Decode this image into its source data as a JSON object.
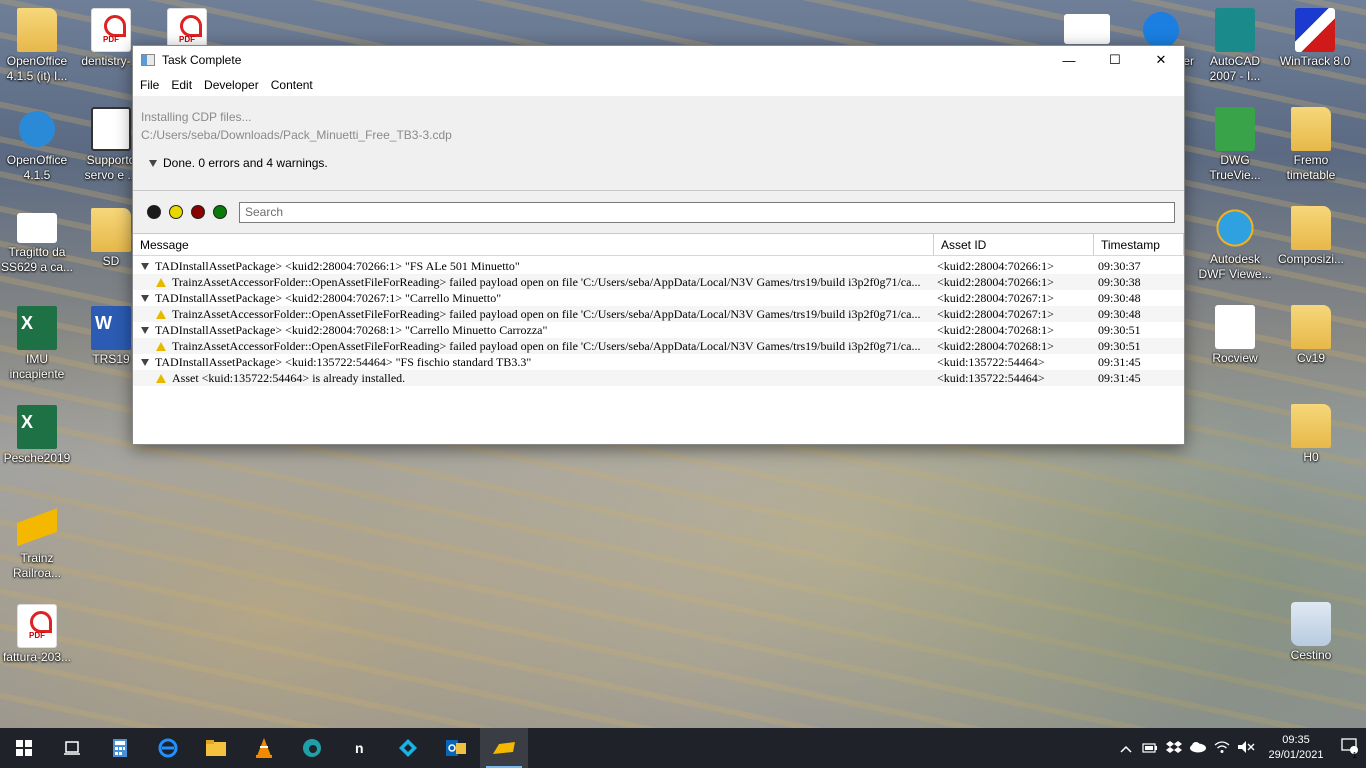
{
  "desktop": {
    "icons_left": [
      {
        "label": "OpenOffice\n4.1.5 (it) I..."
      },
      {
        "label": "dentistry-..."
      },
      {
        "label": "OpenOffice\n4.1.5"
      },
      {
        "label": "Supporto\nservo e ..."
      },
      {
        "label": "Tragitto da\nSS629 a ca..."
      },
      {
        "label": "SD"
      },
      {
        "label": "IMU\nincapiente"
      },
      {
        "label": "TRS19"
      },
      {
        "label": "Pesche2019"
      },
      {
        "label": "Trainz\nRailroa..."
      },
      {
        "label": "fattura-203..."
      }
    ],
    "icons_right": [
      {
        "label": "er"
      },
      {
        "label": "AutoCAD\n2007 - I..."
      },
      {
        "label": "WinTrack 8.0"
      },
      {
        "label": "DWG\nTrueVie..."
      },
      {
        "label": "Fremo\ntimetable"
      },
      {
        "label": "Autodesk\nDWF Viewe..."
      },
      {
        "label": "Composizi..."
      },
      {
        "label": "Rocview"
      },
      {
        "label": "Cv19"
      },
      {
        "label": "H0"
      },
      {
        "label": "Cestino"
      }
    ]
  },
  "window": {
    "title": "Task Complete",
    "controls": {
      "minimize": "—",
      "maximize": "☐",
      "close": "✕"
    },
    "menu": [
      "File",
      "Edit",
      "Developer",
      "Content"
    ],
    "status": {
      "line1": "Installing CDP files...",
      "line2": "C:/Users/seba/Downloads/Pack_Minuetti_Free_TB3-3.cdp",
      "summary": "Done. 0 errors and 4 warnings."
    },
    "filters": {
      "colors": [
        "#1a1a1a",
        "#e8d800",
        "#8b0000",
        "#0a7a0a"
      ],
      "search_placeholder": "Search"
    },
    "table": {
      "headers": {
        "message": "Message",
        "asset_id": "Asset ID",
        "timestamp": "Timestamp"
      },
      "rows": [
        {
          "type": "group",
          "message": "TADInstallAssetPackage> <kuid2:28004:70266:1> \"FS ALe 501 Minuetto\"",
          "asset_id": "<kuid2:28004:70266:1>",
          "timestamp": "09:30:37"
        },
        {
          "type": "warning",
          "message": "TrainzAssetAccessorFolder::OpenAssetFileForReading> failed payload open on file 'C:/Users/seba/AppData/Local/N3V Games/trs19/build i3p2f0g71/ca...",
          "asset_id": "<kuid2:28004:70266:1>",
          "timestamp": "09:30:38"
        },
        {
          "type": "group",
          "message": "TADInstallAssetPackage> <kuid2:28004:70267:1> \"Carrello Minuetto\"",
          "asset_id": "<kuid2:28004:70267:1>",
          "timestamp": "09:30:48"
        },
        {
          "type": "warning",
          "message": "TrainzAssetAccessorFolder::OpenAssetFileForReading> failed payload open on file 'C:/Users/seba/AppData/Local/N3V Games/trs19/build i3p2f0g71/ca...",
          "asset_id": "<kuid2:28004:70267:1>",
          "timestamp": "09:30:48"
        },
        {
          "type": "group",
          "message": "TADInstallAssetPackage> <kuid2:28004:70268:1> \"Carrello Minuetto Carrozza\"",
          "asset_id": "<kuid2:28004:70268:1>",
          "timestamp": "09:30:51"
        },
        {
          "type": "warning",
          "message": "TrainzAssetAccessorFolder::OpenAssetFileForReading> failed payload open on file 'C:/Users/seba/AppData/Local/N3V Games/trs19/build i3p2f0g71/ca...",
          "asset_id": "<kuid2:28004:70268:1>",
          "timestamp": "09:30:51"
        },
        {
          "type": "group",
          "message": "TADInstallAssetPackage> <kuid:135722:54464> \"FS fischio standard TB3.3\"",
          "asset_id": "<kuid:135722:54464>",
          "timestamp": "09:31:45"
        },
        {
          "type": "warning",
          "message": "Asset <kuid:135722:54464> is already installed.",
          "asset_id": "<kuid:135722:54464>",
          "timestamp": "09:31:45"
        }
      ]
    }
  },
  "taskbar": {
    "clock_time": "09:35",
    "clock_date": "29/01/2021",
    "notification_count": "1"
  }
}
